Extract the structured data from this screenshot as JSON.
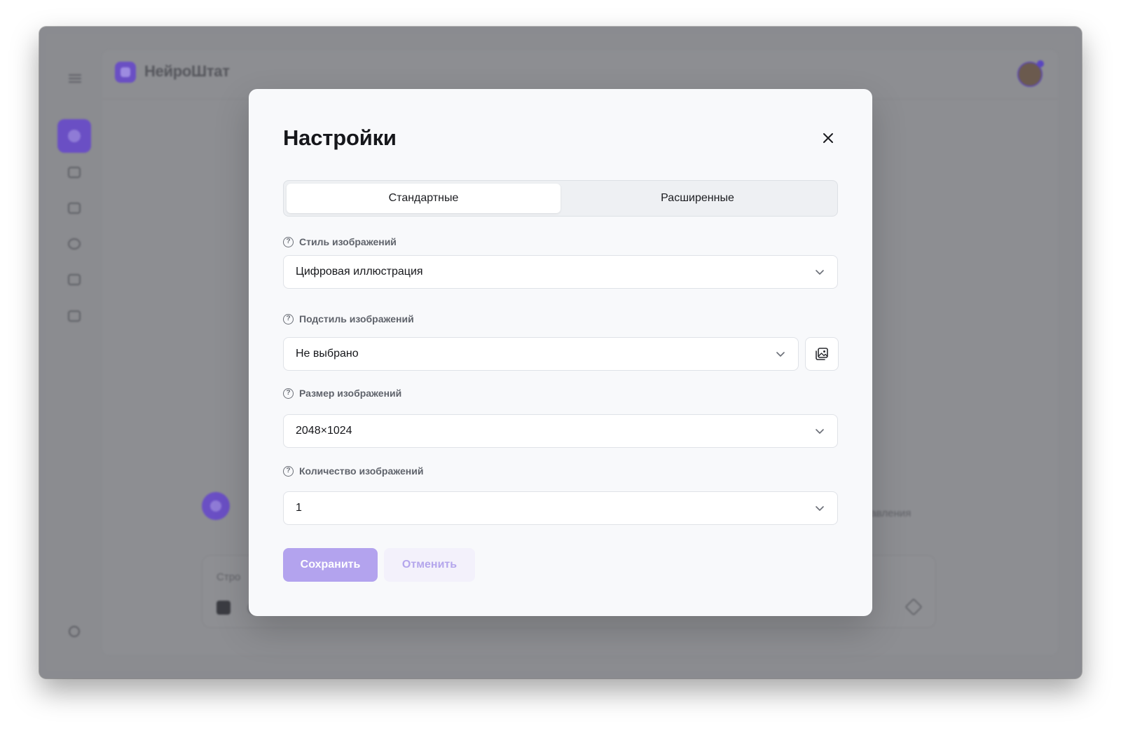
{
  "app": {
    "name": "НейроШтат",
    "composer_placeholder": "Стро",
    "bg_message_fragment": "правления"
  },
  "modal": {
    "title": "Настройки",
    "close_icon": "close-icon",
    "tabs": [
      {
        "label": "Стандартные",
        "active": true
      },
      {
        "label": "Расширенные",
        "active": false
      }
    ],
    "fields": {
      "style": {
        "label": "Стиль изображений",
        "value": "Цифровая иллюстрация"
      },
      "substyle": {
        "label": "Подстиль изображений",
        "value": "Не выбрано"
      },
      "size": {
        "label": "Размер изображений",
        "value": "2048×1024"
      },
      "count": {
        "label": "Количество изображений",
        "value": "1"
      }
    },
    "help_glyph": "?",
    "save_label": "Сохранить",
    "cancel_label": "Отменить"
  },
  "colors": {
    "accent": "#6a4fc4",
    "save_button": "#b3a3ee",
    "cancel_text": "#b4a6ec"
  }
}
